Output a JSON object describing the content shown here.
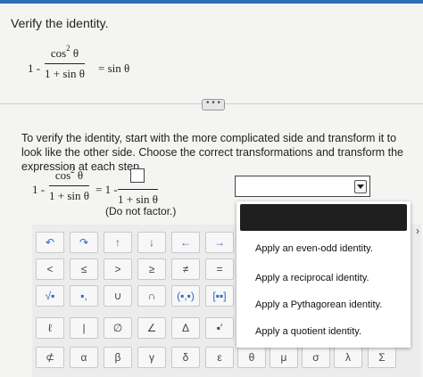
{
  "header": {
    "title": "Verify the identity."
  },
  "identity": {
    "lhs_one": "1 -",
    "numerator": "cos",
    "exponent": "2",
    "numerator_var": "θ",
    "denominator": "1 + sin θ",
    "rhs": "= sin θ"
  },
  "expand_label": "• • •",
  "instructions": "To verify the identity, start with the more complicated side and transform it to look like the other side. Choose the correct transformations and transform the expression at each step.",
  "step": {
    "lhs_one": "1 -",
    "numerator": "cos",
    "exponent": "2",
    "numerator_var": "θ",
    "denominator": "1 + sin θ",
    "equals": "= 1 -",
    "denominator2": "1 + sin θ",
    "note": "(Do not factor.)"
  },
  "transformation_dropdown": {
    "selected": "",
    "options": [
      "Apply an even-odd identity.",
      "Apply a reciprocal identity.",
      "Apply a Pythagorean identity.",
      "Apply a quotient identity."
    ]
  },
  "keypad": {
    "rows": [
      [
        "↶",
        "↷",
        "↑",
        "↓",
        "←",
        "→"
      ],
      [
        "<",
        "≤",
        ">",
        "≥",
        "≠",
        "="
      ],
      [
        "√▪",
        "▪,",
        "∪",
        "∩",
        "(▪,▪)",
        "[▪▪]"
      ],
      [
        "ℓ",
        "|",
        "∅",
        "∠",
        "Δ",
        "▪′"
      ],
      [
        "⊄",
        "α",
        "β",
        "γ",
        "δ",
        "ε",
        "θ",
        "μ",
        "σ",
        "λ",
        "Σ"
      ]
    ],
    "edge_arrow": "›"
  }
}
